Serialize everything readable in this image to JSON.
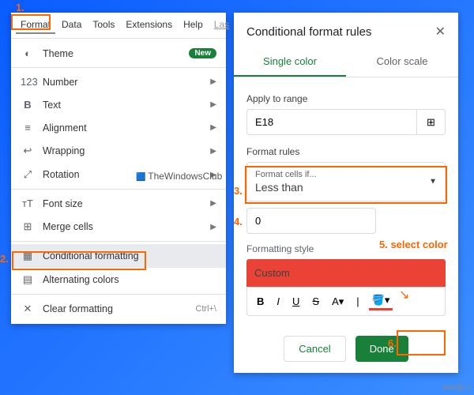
{
  "annotations": {
    "a1": "1.",
    "a2": "2.",
    "a3": "3.",
    "a4": "4.",
    "a5": "5. select color",
    "a6": "6."
  },
  "menubar": {
    "format": "Format",
    "data": "Data",
    "tools": "Tools",
    "extensions": "Extensions",
    "help": "Help",
    "last": "Las"
  },
  "menu": {
    "theme": "Theme",
    "new_badge": "New",
    "number": "Number",
    "text": "Text",
    "alignment": "Alignment",
    "wrapping": "Wrapping",
    "rotation": "Rotation",
    "fontsize": "Font size",
    "merge": "Merge cells",
    "condfmt": "Conditional formatting",
    "altcolors": "Alternating colors",
    "clear": "Clear formatting",
    "clear_short": "Ctrl+\\"
  },
  "sidebar": {
    "title": "Conditional format rules",
    "tab_single": "Single color",
    "tab_scale": "Color scale",
    "apply_label": "Apply to range",
    "range_value": "E18",
    "rules_label": "Format rules",
    "cond_caption": "Format cells if...",
    "cond_value": "Less than",
    "input_value": "0",
    "style_label": "Formatting style",
    "style_preview": "Custom",
    "cancel": "Cancel",
    "done": "Done"
  },
  "watermark": {
    "twc": "TheWindowsClub",
    "waxdp": "waxdp.c"
  }
}
